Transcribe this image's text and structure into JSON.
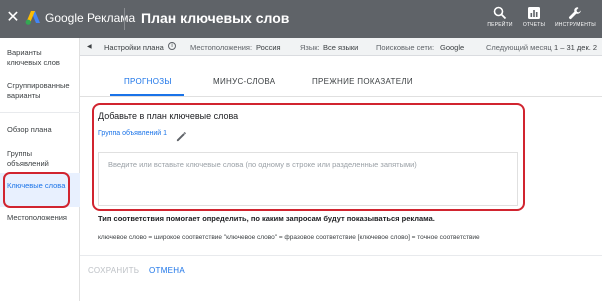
{
  "header": {
    "close_glyph": "✕",
    "brand": "Google Реклама",
    "title": "План ключевых слов",
    "tools": [
      {
        "label": "ПЕРЕЙТИ",
        "icon": "search-icon"
      },
      {
        "label": "ОТЧЕТЫ",
        "icon": "reports-icon"
      },
      {
        "label": "ИНСТРУМЕНТЫ",
        "icon": "wrench-icon"
      }
    ]
  },
  "infobar": {
    "arrow": "◀",
    "plan_settings": "Настройки плана",
    "info_glyph": "i",
    "locations_label": "Местоположения:",
    "locations_value": "Россия",
    "language_label": "Язык:",
    "language_value": "Все языки",
    "network_label": "Поисковые сети:",
    "network_value": "Google",
    "next_month_label": "Следующий месяц",
    "next_month_value": "1 – 31 дек. 2"
  },
  "sidebar": {
    "items": [
      {
        "label": "Варианты ключевых слов"
      },
      {
        "label": "Сгруппированные варианты"
      },
      {
        "label": "Обзор плана"
      },
      {
        "label": "Группы объявлений"
      },
      {
        "label": "Ключевые слова"
      },
      {
        "label": "Местоположения"
      }
    ]
  },
  "tabs": [
    {
      "label": "ПРОГНОЗЫ"
    },
    {
      "label": "МИНУС-СЛОВА"
    },
    {
      "label": "ПРЕЖНИЕ ПОКАЗАТЕЛИ"
    }
  ],
  "add_panel": {
    "title": "Добавьте в план ключевые слова",
    "group_label": "Группа объявлений 1",
    "placeholder": "Введите или вставьте ключевые слова (по одному в строке или разделенные запятыми)"
  },
  "match": {
    "title": "Тип соответствия помогает определить, по каким запросам будут показываться реклама.",
    "description": "ключевое слово = широкое соответствие  \"ключевое слово\" = фразовое соответствие  [ключевое слово] = точное соответствие"
  },
  "actions": {
    "save": "СОХРАНИТЬ",
    "cancel": "ОТМЕНА"
  },
  "colors": {
    "topbar": "#5f6368",
    "accent": "#1a73e8",
    "highlight": "#d1242f"
  }
}
